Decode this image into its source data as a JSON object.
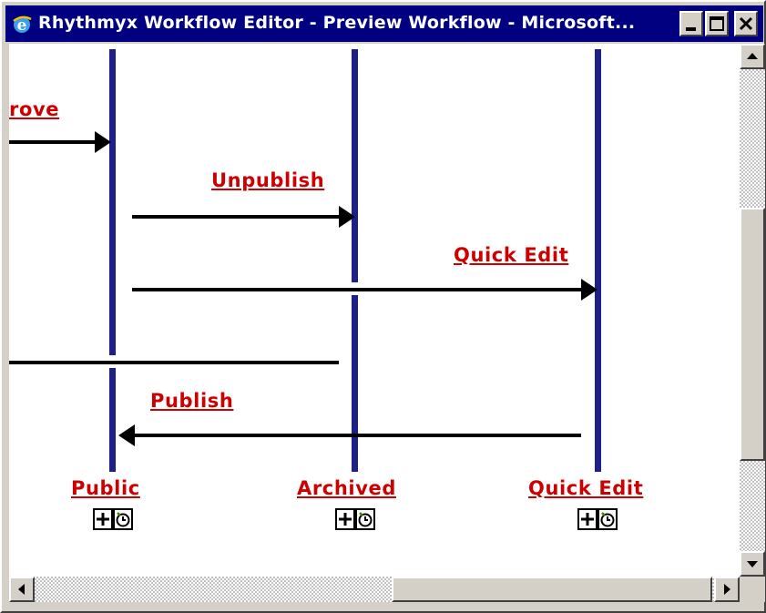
{
  "window": {
    "title": "Rhythmyx Workflow Editor - Preview Workflow - Microsoft..."
  },
  "transitions": [
    {
      "label": "rove"
    },
    {
      "label": "Unpublish"
    },
    {
      "label": "Quick Edit"
    },
    {
      "label": "Publish"
    }
  ],
  "states": [
    {
      "label": "Public"
    },
    {
      "label": "Archived"
    },
    {
      "label": "Quick Edit"
    }
  ],
  "icons": {
    "app": "ie-icon",
    "add": "plus-icon",
    "history": "clock-icon"
  },
  "colors": {
    "titlebar": "#000080",
    "lane": "#1f1f8a",
    "link": "#cc0000",
    "window": "#d4d0c8"
  }
}
